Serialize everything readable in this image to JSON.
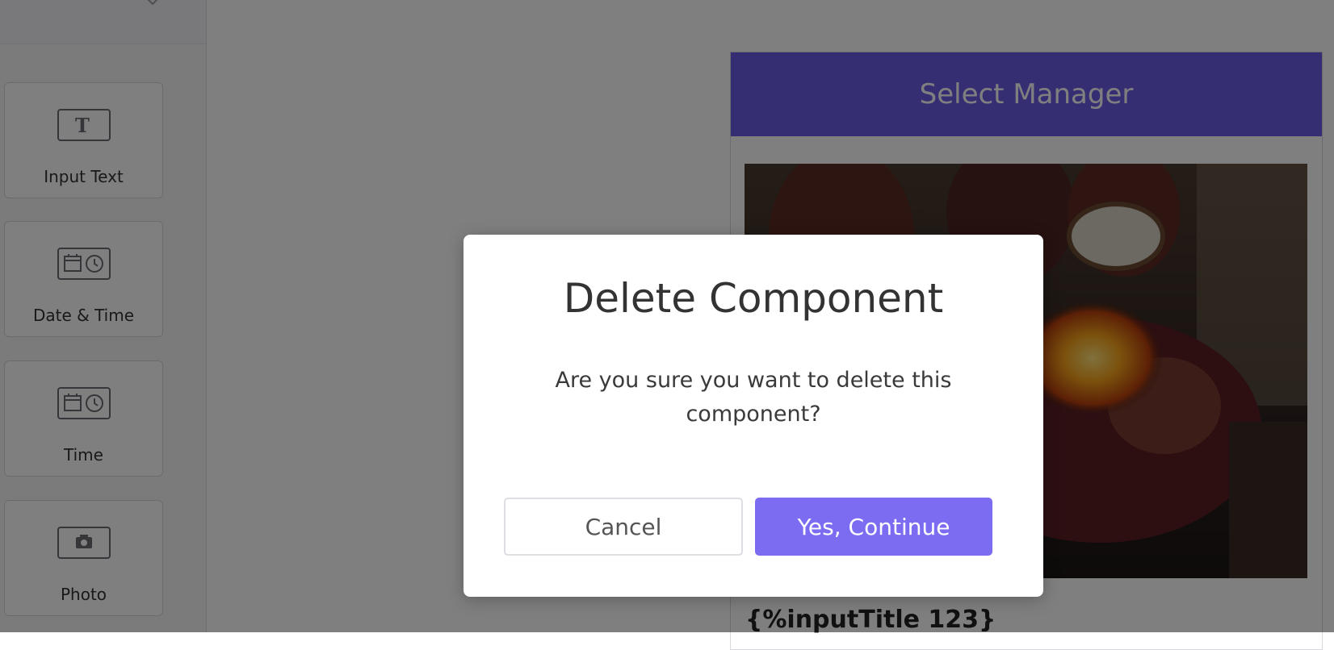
{
  "sidebar": {
    "components": [
      {
        "label": "Input Text",
        "icon": "text-input-icon"
      },
      {
        "label": "Date & Time",
        "icon": "calendar-clock-icon"
      },
      {
        "label": "Time",
        "icon": "calendar-clock-icon"
      },
      {
        "label": "Photo",
        "icon": "camera-icon"
      }
    ]
  },
  "preview": {
    "header_title": "Select Manager",
    "caption": "{%inputTitle 123}"
  },
  "modal": {
    "title": "Delete Component",
    "message": "Are you sure you want to delete this component?",
    "cancel_label": "Cancel",
    "continue_label": "Yes, Continue"
  },
  "colors": {
    "accent": "#7b6cf2",
    "header": "#6c5ce7",
    "overlay": "rgba(0,0,0,0.5)"
  }
}
